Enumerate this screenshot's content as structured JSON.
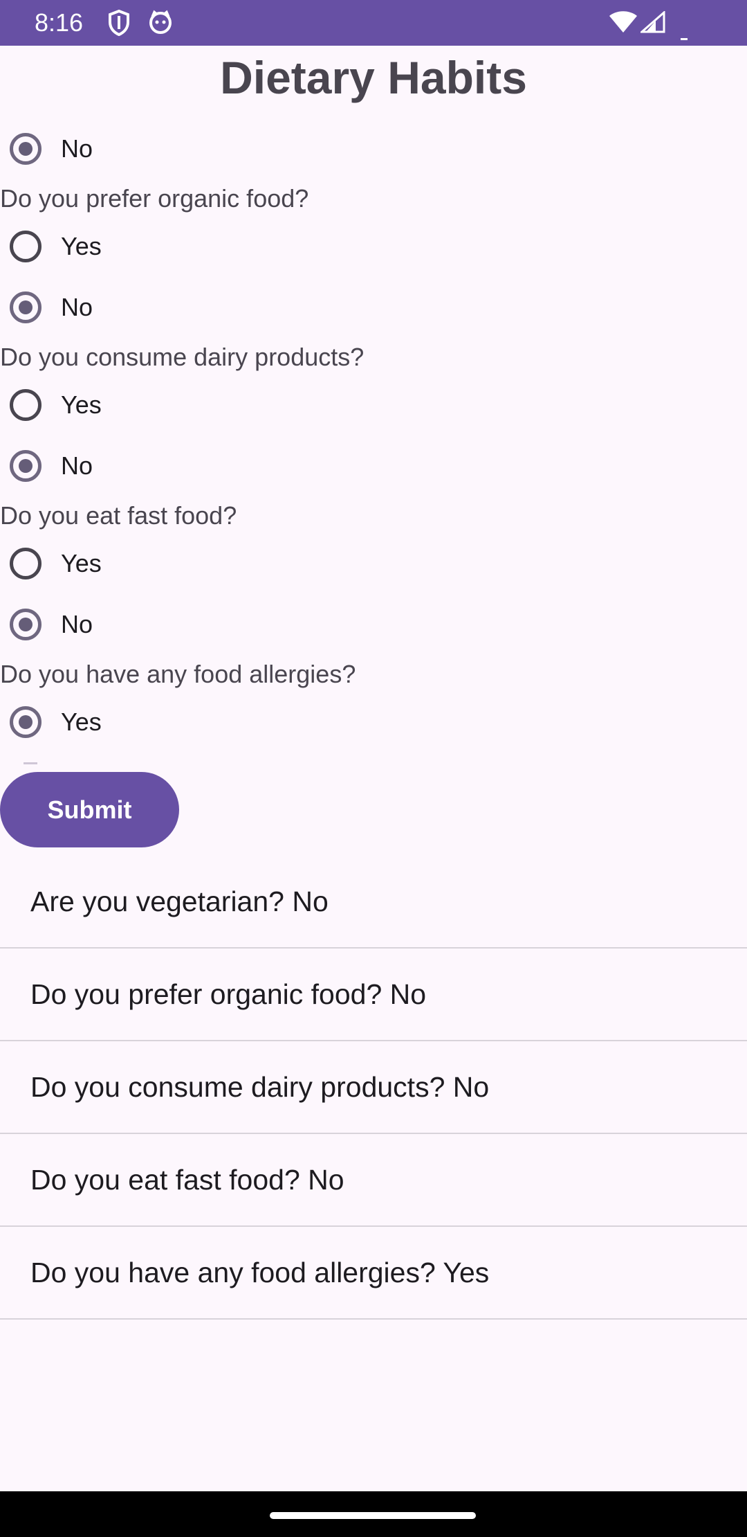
{
  "status": {
    "time": "8:16",
    "icons": [
      "shield-icon",
      "cat-face-icon",
      "wifi-icon",
      "signal-icon",
      "battery-icon"
    ]
  },
  "title": "Dietary Habits",
  "partial_option": {
    "label": "No",
    "checked": true
  },
  "questions": [
    {
      "text": "Do you prefer organic food?",
      "options": [
        {
          "label": "Yes",
          "checked": false
        },
        {
          "label": "No",
          "checked": true
        }
      ]
    },
    {
      "text": "Do you consume dairy products?",
      "options": [
        {
          "label": "Yes",
          "checked": false
        },
        {
          "label": "No",
          "checked": true
        }
      ]
    },
    {
      "text": "Do you eat fast food?",
      "options": [
        {
          "label": "Yes",
          "checked": false
        },
        {
          "label": "No",
          "checked": true
        }
      ]
    },
    {
      "text": "Do you have any food allergies?",
      "options": [
        {
          "label": "Yes",
          "checked": true
        }
      ]
    }
  ],
  "submit_label": "Submit",
  "results": [
    "Are you vegetarian? No",
    "Do you prefer organic food? No",
    "Do you consume dairy products? No",
    "Do you eat fast food? No",
    "Do you have any food allergies? Yes"
  ],
  "colors": {
    "primary": "#6750a4",
    "background": "#fdf7fd",
    "radio_checked": "#655d78"
  }
}
